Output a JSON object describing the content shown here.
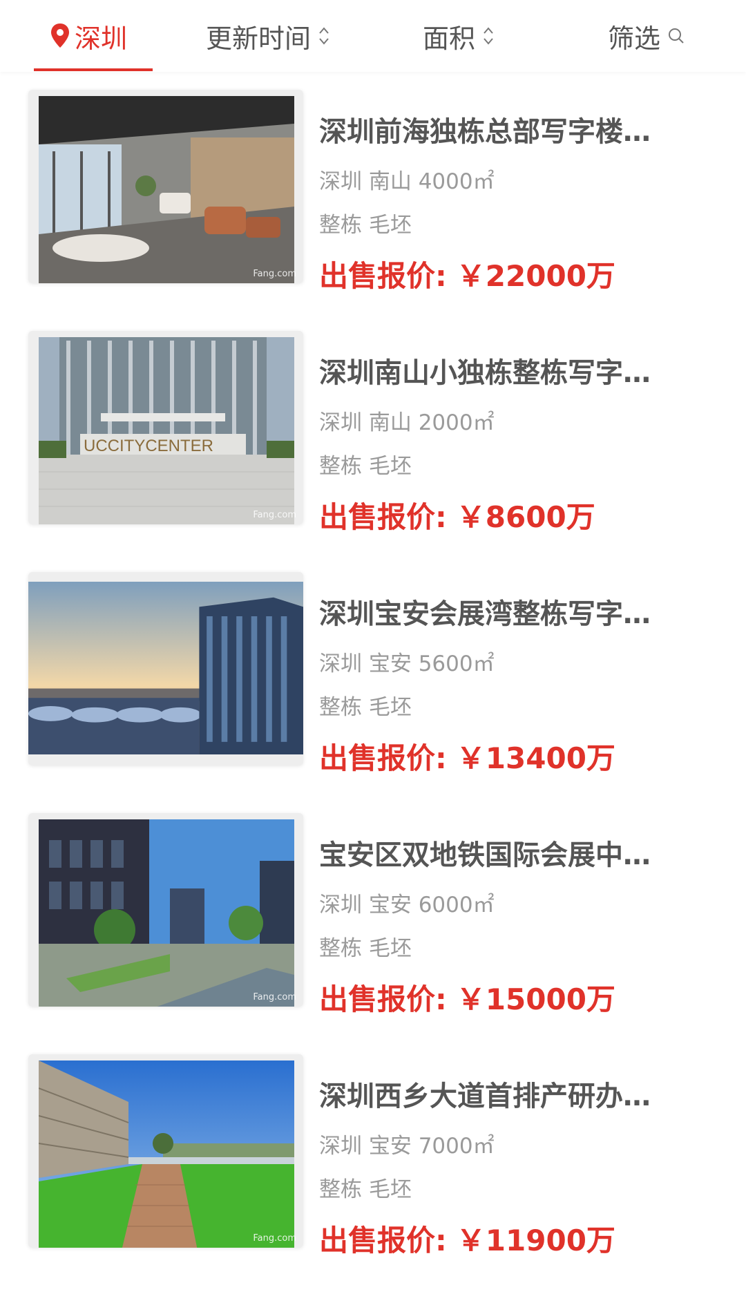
{
  "colors": {
    "accent": "#e0322a",
    "text_title": "#555555",
    "text_meta": "#9a9a9a"
  },
  "filter_bar": {
    "city": "深圳",
    "update_time": "更新时间",
    "area": "面积",
    "filter": "筛选"
  },
  "listings": [
    {
      "title": "深圳前海独栋总部写字楼…",
      "location": "深圳 南山 4000㎡",
      "tags": "整栋 毛坯",
      "price_label": "出售报价:",
      "price": "￥22000万",
      "watermark": "Fang.com"
    },
    {
      "title": "深圳南山小独栋整栋写字…",
      "location": "深圳 南山 2000㎡",
      "tags": "整栋 毛坯",
      "price_label": "出售报价:",
      "price": "￥8600万",
      "watermark": "Fang.com",
      "image_text": "UCCITYCENTER"
    },
    {
      "title": "深圳宝安会展湾整栋写字…",
      "location": "深圳 宝安 5600㎡",
      "tags": "整栋 毛坯",
      "price_label": "出售报价:",
      "price": "￥13400万"
    },
    {
      "title": "宝安区双地铁国际会展中…",
      "location": "深圳 宝安 6000㎡",
      "tags": "整栋 毛坯",
      "price_label": "出售报价:",
      "price": "￥15000万",
      "watermark": "Fang.com"
    },
    {
      "title": "深圳西乡大道首排产研办…",
      "location": "深圳 宝安 7000㎡",
      "tags": "整栋 毛坯",
      "price_label": "出售报价:",
      "price": "￥11900万",
      "watermark": "Fang.com"
    }
  ]
}
